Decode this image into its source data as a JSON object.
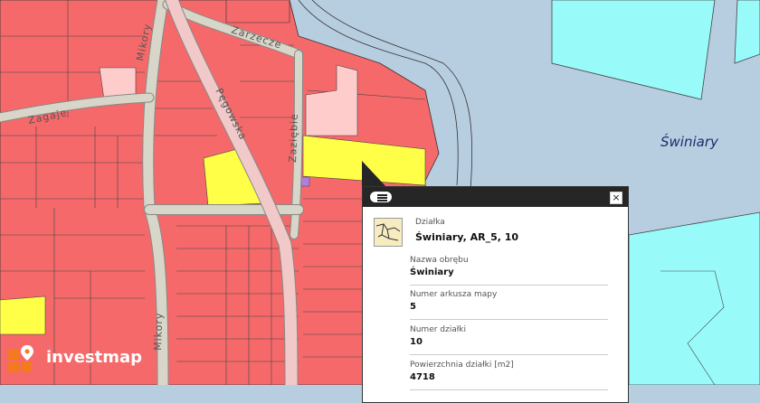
{
  "map": {
    "streets": [
      "Mikory",
      "Zarzecze",
      "Zagaje",
      "Pęgowska",
      "Zaziębie",
      "Mikory"
    ],
    "place": "Świniary",
    "colors": {
      "parcel": "#f5696a",
      "water": "#b7cde0",
      "meadow": "#99fafa",
      "yellow": "#ffff47",
      "road": "#d8d6c8",
      "light": "#ffcccc"
    }
  },
  "popup": {
    "title_label": "Działka",
    "title_value": "Świniary, AR_5, 10",
    "fields": [
      {
        "label": "Nazwa obrębu",
        "value": "Świniary"
      },
      {
        "label": "Numer arkusza mapy",
        "value": "5"
      },
      {
        "label": "Numer działki",
        "value": "10"
      },
      {
        "label": "Powierzchnia działki [m2]",
        "value": "4718"
      }
    ],
    "menu_icon": "list-icon",
    "close_icon": "close-icon",
    "close_glyph": "×"
  },
  "logo": {
    "text": "investmap"
  }
}
